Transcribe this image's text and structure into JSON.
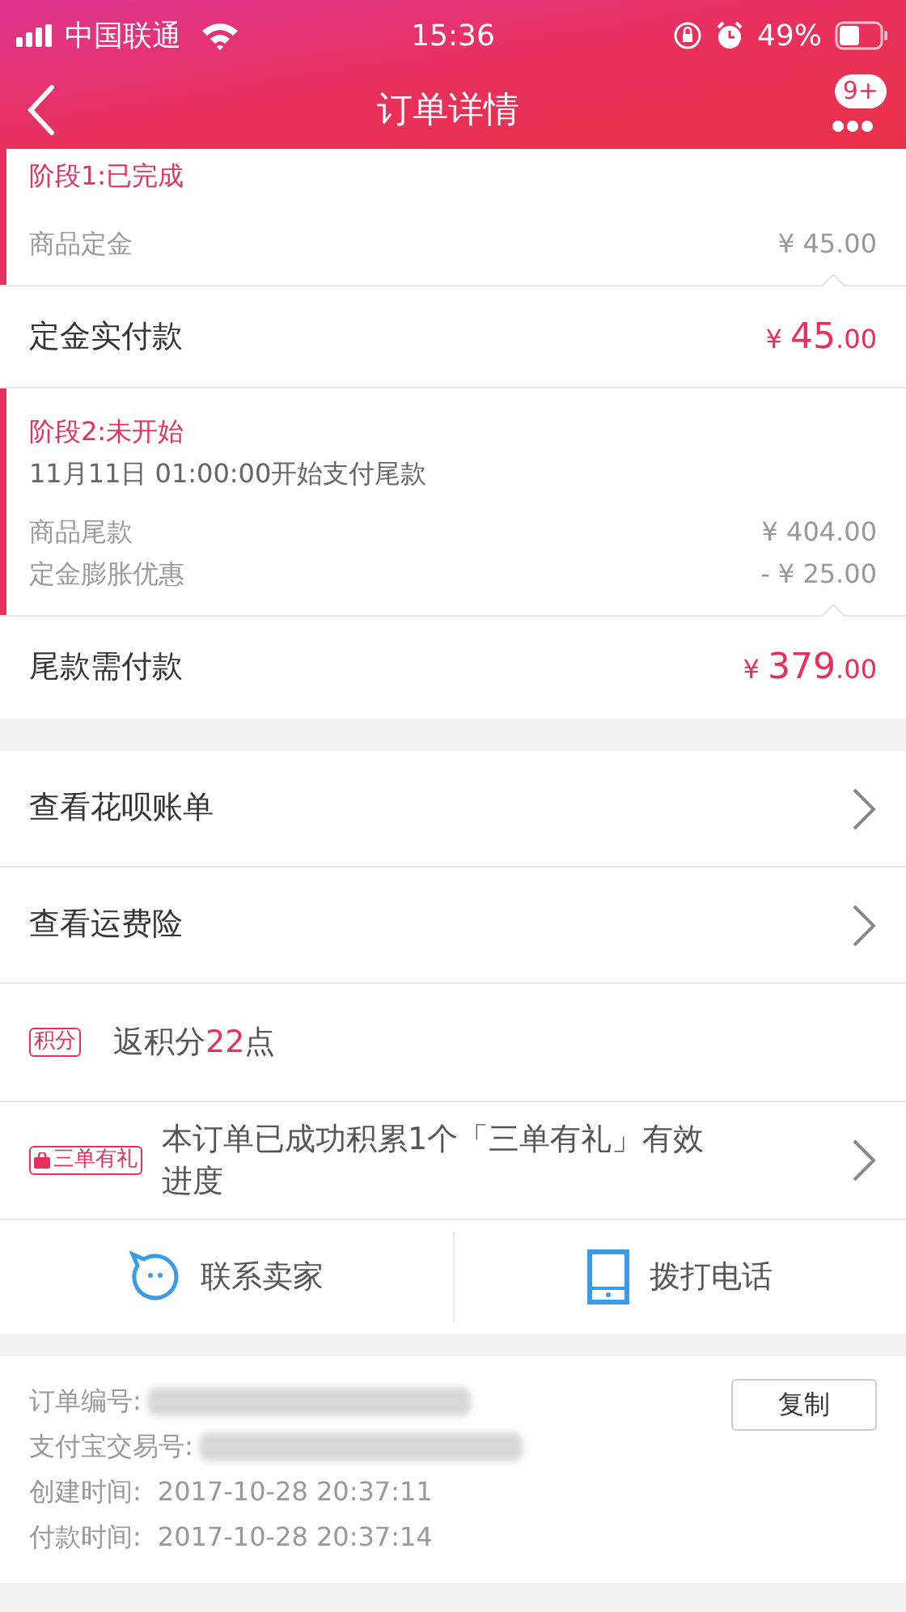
{
  "status_bar": {
    "carrier": "中国联通",
    "time": "15:36",
    "battery": "49%"
  },
  "nav": {
    "title": "订单详情",
    "badge": "9+"
  },
  "stages": [
    {
      "title": "阶段1:已完成",
      "lines": [
        {
          "label": "商品定金",
          "amount": "¥ 45.00"
        }
      ],
      "total": {
        "label": "定金实付款",
        "currency": "¥ ",
        "whole": "45",
        "fraction": ".00"
      }
    },
    {
      "title": "阶段2:未开始",
      "note": "11月11日 01:00:00开始支付尾款",
      "lines": [
        {
          "label": "商品尾款",
          "amount": "¥ 404.00"
        },
        {
          "label": "定金膨胀优惠",
          "amount": "- ¥ 25.00"
        }
      ],
      "total": {
        "label": "尾款需付款",
        "currency": "¥ ",
        "whole": "379",
        "fraction": ".00"
      }
    }
  ],
  "links": [
    {
      "label": "查看花呗账单"
    },
    {
      "label": "查看运费险"
    }
  ],
  "points": {
    "tag": "积分",
    "before": "返积分",
    "value": "22",
    "after": "点"
  },
  "promo": {
    "tag": "三单有礼",
    "text": "本订单已成功积累1个「三单有礼」有效进度"
  },
  "actions": [
    {
      "kind": "chat",
      "label": "联系卖家"
    },
    {
      "kind": "phone",
      "label": "拨打电话"
    }
  ],
  "info": {
    "copy_button": "复制",
    "rows": [
      {
        "label": "订单编号:",
        "value": null,
        "redacted": true
      },
      {
        "label": "支付宝交易号:",
        "value": null,
        "redacted": true
      },
      {
        "label": "创建时间:",
        "value": "2017-10-28 20:37:11",
        "redacted": false
      },
      {
        "label": "付款时间:",
        "value": "2017-10-28 20:37:14",
        "redacted": false
      }
    ]
  }
}
